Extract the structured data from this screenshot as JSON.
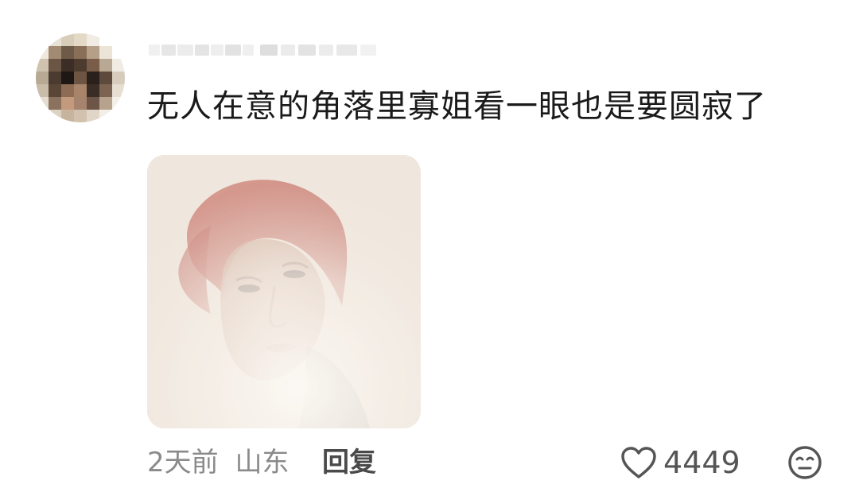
{
  "comment": {
    "username": "",
    "text": "无人在意的角落里寡姐看一眼也是要圆寂了",
    "time": "2天前",
    "location": "山东",
    "reply_label": "回复",
    "like_count": "4449",
    "icons": {
      "like": "heart-outline-icon",
      "reaction": "neutral-face-icon"
    },
    "colors": {
      "text": "#1a1a1a",
      "meta": "#8a8a8a",
      "icon": "#555555"
    }
  }
}
